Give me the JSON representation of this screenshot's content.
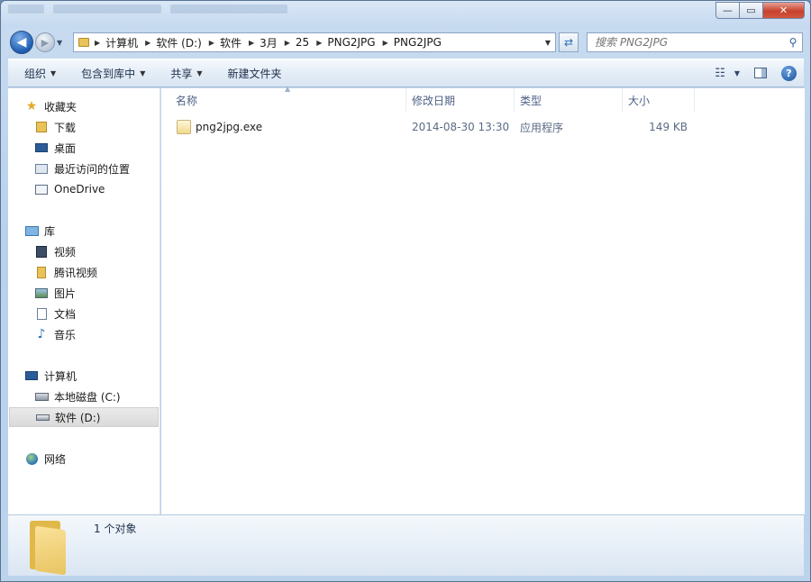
{
  "window": {
    "buttons": {
      "minimize": "—",
      "maximize": "▭",
      "close": "✕"
    }
  },
  "nav": {
    "back_icon": "◀",
    "forward_icon": "▶",
    "breadcrumbs": [
      "计算机",
      "软件 (D:)",
      "软件",
      "3月",
      "25",
      "PNG2JPG",
      "PNG2JPG"
    ],
    "search_placeholder": "搜索 PNG2JPG"
  },
  "toolbar": {
    "organize": "组织",
    "include_library": "包含到库中",
    "share": "共享",
    "new_folder": "新建文件夹"
  },
  "sidebar": {
    "favorites": {
      "label": "收藏夹",
      "items": [
        "下载",
        "桌面",
        "最近访问的位置",
        "OneDrive"
      ]
    },
    "libraries": {
      "label": "库",
      "items": [
        "视频",
        "腾讯视频",
        "图片",
        "文档",
        "音乐"
      ]
    },
    "computer": {
      "label": "计算机",
      "items": [
        "本地磁盘 (C:)",
        "软件 (D:)"
      ]
    },
    "network": {
      "label": "网络"
    }
  },
  "columns": {
    "name": "名称",
    "modified": "修改日期",
    "type": "类型",
    "size": "大小"
  },
  "files": [
    {
      "name": "png2jpg.exe",
      "modified": "2014-08-30 13:30",
      "type": "应用程序",
      "size": "149 KB"
    }
  ],
  "details": {
    "count": "1 个对象"
  },
  "colors": {
    "accent": "#1e5db0",
    "selected_bg": "#dadada",
    "header_text": "#4d6185"
  }
}
